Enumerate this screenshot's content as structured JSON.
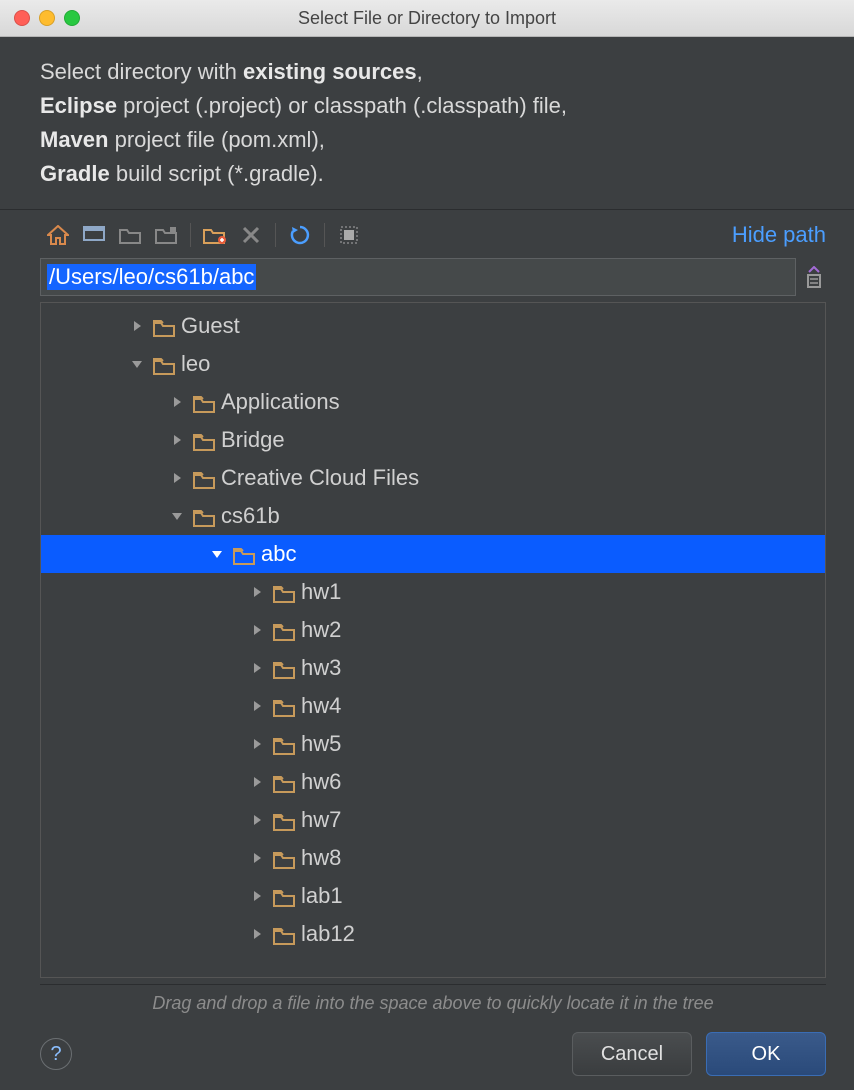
{
  "title": "Select File or Directory to Import",
  "instructions": {
    "l1a": "Select directory with ",
    "l1b": "existing sources",
    "l2a": "Eclipse",
    "l2b": " project (.project) or classpath (.classpath) file,",
    "l3a": "Maven",
    "l3b": " project file (pom.xml),",
    "l4a": "Gradle",
    "l4b": " build script (*.gradle)."
  },
  "toolbar": {
    "hide_path": "Hide path",
    "icons": [
      "home",
      "desktop",
      "project",
      "module",
      "new-folder",
      "delete",
      "refresh",
      "show-hidden"
    ]
  },
  "path": {
    "value": "/Users/leo/cs61b/abc"
  },
  "tree": [
    {
      "depth": 0,
      "arrow": "right",
      "label": "Guest",
      "selected": false
    },
    {
      "depth": 0,
      "arrow": "down",
      "label": "leo",
      "selected": false
    },
    {
      "depth": 1,
      "arrow": "right",
      "label": "Applications",
      "selected": false
    },
    {
      "depth": 1,
      "arrow": "right",
      "label": "Bridge",
      "selected": false
    },
    {
      "depth": 1,
      "arrow": "right",
      "label": "Creative Cloud Files",
      "selected": false
    },
    {
      "depth": 1,
      "arrow": "down",
      "label": "cs61b",
      "selected": false
    },
    {
      "depth": 2,
      "arrow": "down",
      "label": "abc",
      "selected": true
    },
    {
      "depth": 3,
      "arrow": "right",
      "label": "hw1",
      "selected": false
    },
    {
      "depth": 3,
      "arrow": "right",
      "label": "hw2",
      "selected": false
    },
    {
      "depth": 3,
      "arrow": "right",
      "label": "hw3",
      "selected": false
    },
    {
      "depth": 3,
      "arrow": "right",
      "label": "hw4",
      "selected": false
    },
    {
      "depth": 3,
      "arrow": "right",
      "label": "hw5",
      "selected": false
    },
    {
      "depth": 3,
      "arrow": "right",
      "label": "hw6",
      "selected": false
    },
    {
      "depth": 3,
      "arrow": "right",
      "label": "hw7",
      "selected": false
    },
    {
      "depth": 3,
      "arrow": "right",
      "label": "hw8",
      "selected": false
    },
    {
      "depth": 3,
      "arrow": "right",
      "label": "lab1",
      "selected": false
    },
    {
      "depth": 3,
      "arrow": "right",
      "label": "lab12",
      "selected": false
    }
  ],
  "hints": {
    "dragdrop": "Drag and drop a file into the space above to quickly locate it in the tree"
  },
  "footer": {
    "cancel": "Cancel",
    "ok": "OK"
  },
  "colors": {
    "accent": "#0a5cff",
    "link": "#4b9eff",
    "folder": "#d9a05a",
    "bg": "#3c3f41"
  }
}
